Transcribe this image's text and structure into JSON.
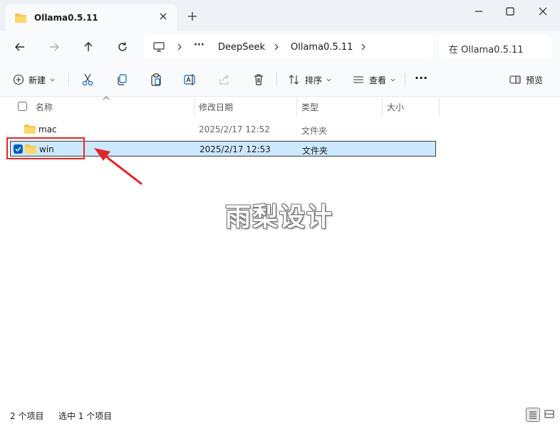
{
  "tab": {
    "title": "Ollama0.5.11",
    "icon": "folder-icon"
  },
  "window_controls": [
    "minimize-icon",
    "maximize-icon",
    "close-icon"
  ],
  "navigation": {
    "buttons": [
      "back-icon",
      "forward-icon",
      "up-icon",
      "refresh-icon"
    ]
  },
  "address_bar": {
    "root_icon": "computer-icon",
    "overflow": "···",
    "crumbs": [
      "DeepSeek",
      "Ollama0.5.11"
    ]
  },
  "search": {
    "placeholder": "在 Ollama0.5.11"
  },
  "toolbar": {
    "new_label": "新建",
    "sort_label": "排序",
    "view_label": "查看",
    "more": "···",
    "preview_label": "预览",
    "icons": [
      "cut-icon",
      "copy-icon",
      "paste-icon",
      "rename-icon",
      "share-icon",
      "delete-icon"
    ]
  },
  "columns": {
    "name": "名称",
    "modified": "修改日期",
    "type": "类型",
    "size": "大小"
  },
  "files": [
    {
      "name": "mac",
      "modified": "2025/2/17 12:52",
      "type": "文件夹",
      "selected": false
    },
    {
      "name": "win",
      "modified": "2025/2/17 12:53",
      "type": "文件夹",
      "selected": true
    }
  ],
  "watermark": "雨梨设计",
  "status": {
    "count": "2 个项目",
    "selection": "选中 1 个项目"
  },
  "colors": {
    "selection_bg": "#cce8ff",
    "accent": "#005fb8",
    "annotation": "#e0272b",
    "folder": "#f7c64d"
  }
}
